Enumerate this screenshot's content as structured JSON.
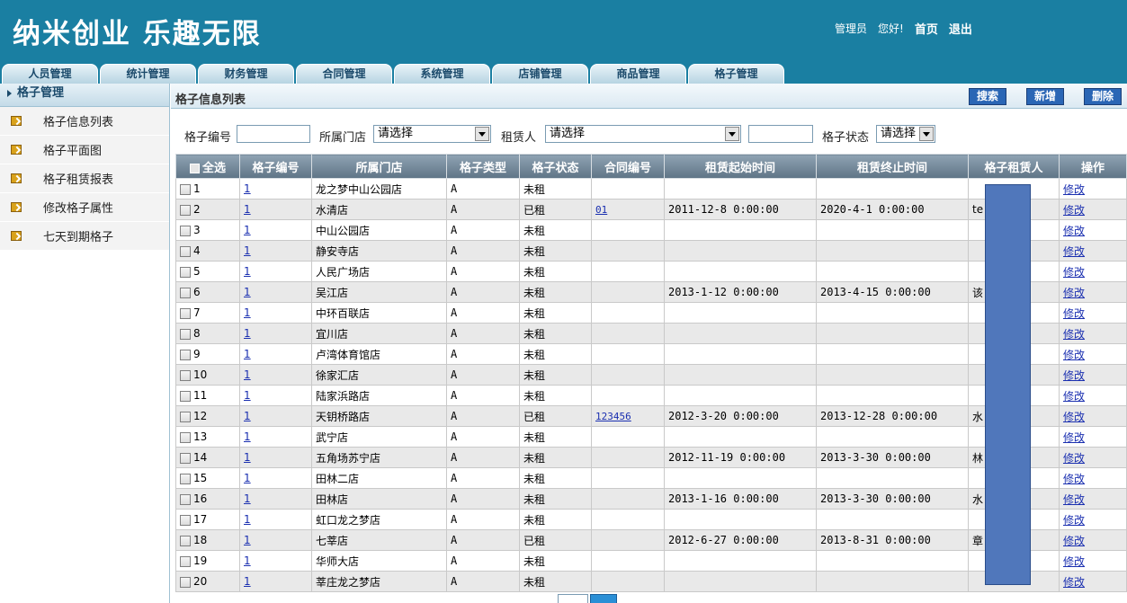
{
  "header": {
    "brand": "纳米创业 乐趣无限",
    "user_role": "管理员",
    "greeting": "您好!",
    "home_link": "首页",
    "logout_link": "退出"
  },
  "tabs": [
    "人员管理",
    "统计管理",
    "财务管理",
    "合同管理",
    "系统管理",
    "店铺管理",
    "商品管理",
    "格子管理"
  ],
  "sidebar": {
    "title": "格子管理",
    "items": [
      "格子信息列表",
      "格子平面图",
      "格子租赁报表",
      "修改格子属性",
      "七天到期格子"
    ]
  },
  "main": {
    "title": "格子信息列表",
    "actions": {
      "search": "搜索",
      "add": "新增",
      "delete": "删除"
    }
  },
  "filter": {
    "grid_no_label": "格子编号",
    "grid_no_value": "",
    "store_label": "所属门店",
    "store_value": "请选择",
    "renter_label": "租赁人",
    "renter_value": "请选择",
    "renter_extra_value": "",
    "status_label": "格子状态",
    "status_value": "请选择"
  },
  "table": {
    "columns": [
      "全选",
      "格子编号",
      "所属门店",
      "格子类型",
      "格子状态",
      "合同编号",
      "租赁起始时间",
      "租赁终止时间",
      "格子租赁人",
      "操作"
    ],
    "edit_label": "修改",
    "rows": [
      {
        "idx": "1",
        "code": "1",
        "store": "龙之梦中山公园店",
        "type": "A",
        "status": "未租",
        "contract": "",
        "start": "",
        "end": "",
        "renter": ""
      },
      {
        "idx": "2",
        "code": "1",
        "store": "水清店",
        "type": "A",
        "status": "已租",
        "contract": "01",
        "start": "2011-12-8 0:00:00",
        "end": "2020-4-1 0:00:00",
        "renter": "te"
      },
      {
        "idx": "3",
        "code": "1",
        "store": "中山公园店",
        "type": "A",
        "status": "未租",
        "contract": "",
        "start": "",
        "end": "",
        "renter": ""
      },
      {
        "idx": "4",
        "code": "1",
        "store": "静安寺店",
        "type": "A",
        "status": "未租",
        "contract": "",
        "start": "",
        "end": "",
        "renter": ""
      },
      {
        "idx": "5",
        "code": "1",
        "store": "人民广场店",
        "type": "A",
        "status": "未租",
        "contract": "",
        "start": "",
        "end": "",
        "renter": ""
      },
      {
        "idx": "6",
        "code": "1",
        "store": "吴江店",
        "type": "A",
        "status": "未租",
        "contract": "",
        "start": "2013-1-12 0:00:00",
        "end": "2013-4-15 0:00:00",
        "renter": "该"
      },
      {
        "idx": "7",
        "code": "1",
        "store": "中环百联店",
        "type": "A",
        "status": "未租",
        "contract": "",
        "start": "",
        "end": "",
        "renter": ""
      },
      {
        "idx": "8",
        "code": "1",
        "store": "宜川店",
        "type": "A",
        "status": "未租",
        "contract": "",
        "start": "",
        "end": "",
        "renter": ""
      },
      {
        "idx": "9",
        "code": "1",
        "store": "卢湾体育馆店",
        "type": "A",
        "status": "未租",
        "contract": "",
        "start": "",
        "end": "",
        "renter": ""
      },
      {
        "idx": "10",
        "code": "1",
        "store": "徐家汇店",
        "type": "A",
        "status": "未租",
        "contract": "",
        "start": "",
        "end": "",
        "renter": ""
      },
      {
        "idx": "11",
        "code": "1",
        "store": "陆家浜路店",
        "type": "A",
        "status": "未租",
        "contract": "",
        "start": "",
        "end": "",
        "renter": ""
      },
      {
        "idx": "12",
        "code": "1",
        "store": "天钥桥路店",
        "type": "A",
        "status": "已租",
        "contract": "123456",
        "start": "2012-3-20 0:00:00",
        "end": "2013-12-28 0:00:00",
        "renter": "水"
      },
      {
        "idx": "13",
        "code": "1",
        "store": "武宁店",
        "type": "A",
        "status": "未租",
        "contract": "",
        "start": "",
        "end": "",
        "renter": ""
      },
      {
        "idx": "14",
        "code": "1",
        "store": "五角场苏宁店",
        "type": "A",
        "status": "未租",
        "contract": "",
        "start": "2012-11-19 0:00:00",
        "end": "2013-3-30 0:00:00",
        "renter": "林"
      },
      {
        "idx": "15",
        "code": "1",
        "store": "田林二店",
        "type": "A",
        "status": "未租",
        "contract": "",
        "start": "",
        "end": "",
        "renter": ""
      },
      {
        "idx": "16",
        "code": "1",
        "store": "田林店",
        "type": "A",
        "status": "未租",
        "contract": "",
        "start": "2013-1-16 0:00:00",
        "end": "2013-3-30 0:00:00",
        "renter": "水"
      },
      {
        "idx": "17",
        "code": "1",
        "store": "虹口龙之梦店",
        "type": "A",
        "status": "未租",
        "contract": "",
        "start": "",
        "end": "",
        "renter": ""
      },
      {
        "idx": "18",
        "code": "1",
        "store": "七莘店",
        "type": "A",
        "status": "已租",
        "contract": "",
        "start": "2012-6-27 0:00:00",
        "end": "2013-8-31 0:00:00",
        "renter": "章"
      },
      {
        "idx": "19",
        "code": "1",
        "store": "华师大店",
        "type": "A",
        "status": "未租",
        "contract": "",
        "start": "",
        "end": "",
        "renter": ""
      },
      {
        "idx": "20",
        "code": "1",
        "store": "莘庄龙之梦店",
        "type": "A",
        "status": "未租",
        "contract": "",
        "start": "",
        "end": "",
        "renter": ""
      }
    ]
  },
  "colors": {
    "header_bg": "#1a7fa2",
    "redaction": "#5077bb",
    "link": "#1a2fb0"
  }
}
